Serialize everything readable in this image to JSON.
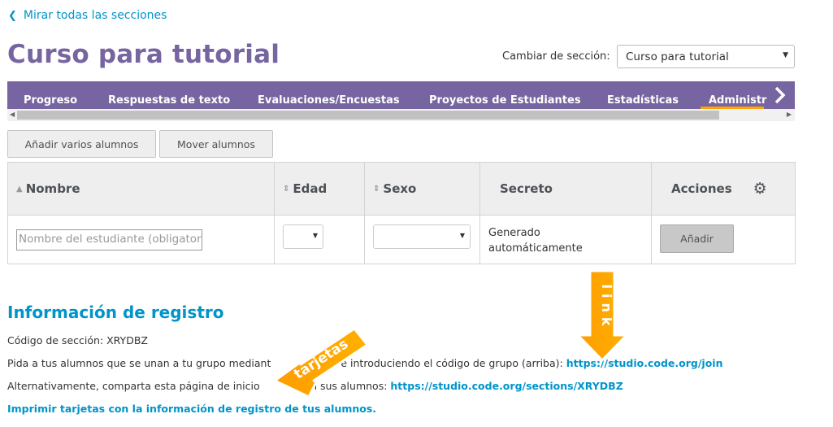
{
  "back_link": "Mirar todas las secciones",
  "page_title": "Curso para tutorial",
  "section_switch": {
    "label": "Cambiar de sección:",
    "value": "Curso para tutorial"
  },
  "tabs": [
    {
      "label": "Progreso"
    },
    {
      "label": "Respuestas de texto"
    },
    {
      "label": "Evaluaciones/Encuestas"
    },
    {
      "label": "Proyectos de Estudiantes"
    },
    {
      "label": "Estadísticas"
    },
    {
      "label": "Administr"
    }
  ],
  "buttons": {
    "add_multiple": "Añadir varios alumnos",
    "move": "Mover alumnos"
  },
  "table": {
    "headers": {
      "name": "Nombre",
      "age": "Edad",
      "gender": "Sexo",
      "secret": "Secreto",
      "actions": "Acciones"
    },
    "new_row": {
      "name_placeholder": "Nombre del estudiante (obligatorio)",
      "secret": "Generado automáticamente",
      "add_label": "Añadir"
    }
  },
  "registration": {
    "heading": "Información de registro",
    "code_line": "Código de sección: XRYDBZ",
    "join_prefix": "Pida a tus alumnos que se unan a tu grupo mediant",
    "join_middle": "e introduciendo el código de grupo (arriba): ",
    "join_link": "https://studio.code.org/join",
    "alt_prefix": "Alternativamente, comparta esta página de inicio ",
    "alt_middle": " con sus alumnos: ",
    "alt_link": "https://studio.code.org/sections/XRYDBZ",
    "print_link": "Imprimir tarjetas con la información de registro de tus alumnos."
  },
  "annotations": {
    "arrow_cards": "tarjetas",
    "arrow_link": "link"
  },
  "colors": {
    "brand_purple": "#7665a0",
    "link_blue": "#0094ca",
    "accent_orange": "#ffa400"
  }
}
